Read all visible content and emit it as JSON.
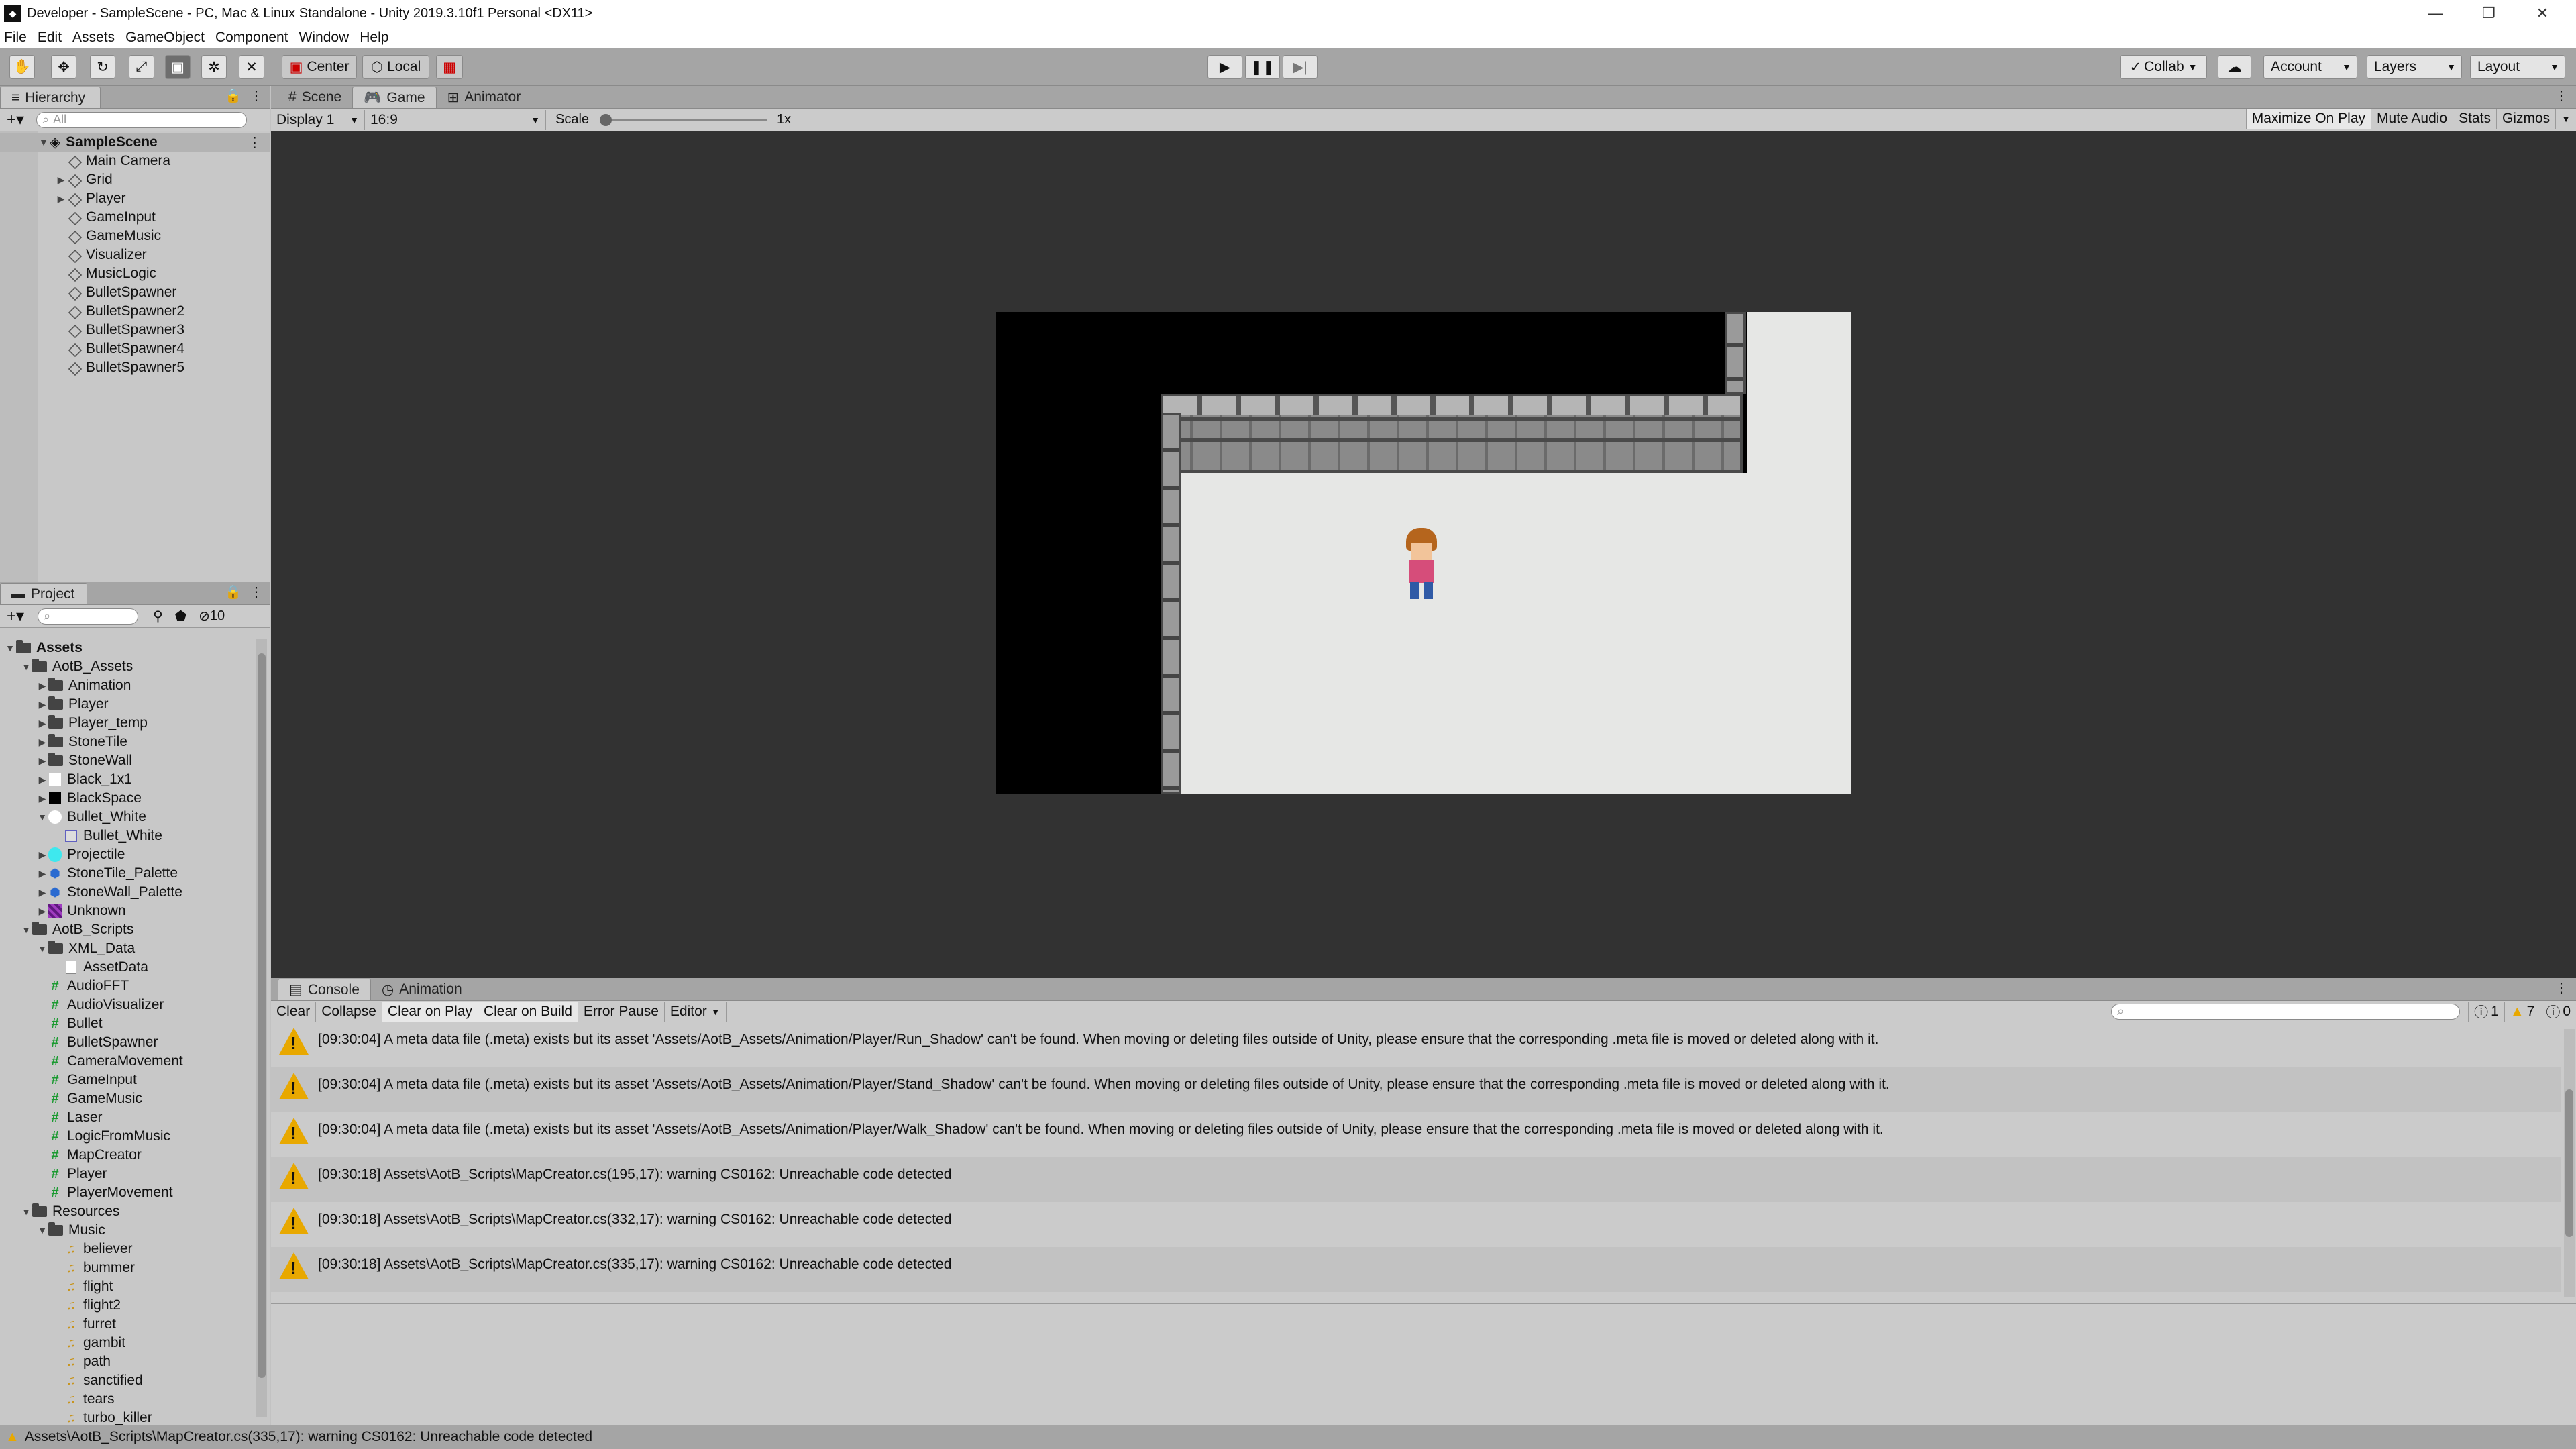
{
  "window": {
    "title": "Developer - SampleScene - PC, Mac & Linux Standalone - Unity 2019.3.10f1 Personal <DX11>"
  },
  "menu": [
    "File",
    "Edit",
    "Assets",
    "GameObject",
    "Component",
    "Window",
    "Help"
  ],
  "toolbar": {
    "center": "Center",
    "local": "Local",
    "collab": "Collab",
    "account": "Account",
    "layers": "Layers",
    "layout": "Layout"
  },
  "hierarchy": {
    "tab": "Hierarchy",
    "search_placeholder": "All",
    "scene": "SampleScene",
    "items": [
      "Main Camera",
      "Grid",
      "Player",
      "GameInput",
      "GameMusic",
      "Visualizer",
      "MusicLogic",
      "BulletSpawner",
      "BulletSpawner2",
      "BulletSpawner3",
      "BulletSpawner4",
      "BulletSpawner5"
    ]
  },
  "project": {
    "tab": "Project",
    "hidden_count": "10",
    "tree": [
      {
        "label": "Assets",
        "depth": 0,
        "type": "folder",
        "arrow": "down",
        "bold": true
      },
      {
        "label": "AotB_Assets",
        "depth": 1,
        "type": "folder",
        "arrow": "down"
      },
      {
        "label": "Animation",
        "depth": 2,
        "type": "folder",
        "arrow": "right"
      },
      {
        "label": "Player",
        "depth": 2,
        "type": "folder",
        "arrow": "right"
      },
      {
        "label": "Player_temp",
        "depth": 2,
        "type": "folder",
        "arrow": "right"
      },
      {
        "label": "StoneTile",
        "depth": 2,
        "type": "folder",
        "arrow": "right"
      },
      {
        "label": "StoneWall",
        "depth": 2,
        "type": "folder",
        "arrow": "right"
      },
      {
        "label": "Black_1x1",
        "depth": 2,
        "type": "white",
        "arrow": "right"
      },
      {
        "label": "BlackSpace",
        "depth": 2,
        "type": "black",
        "arrow": "right"
      },
      {
        "label": "Bullet_White",
        "depth": 2,
        "type": "circle",
        "arrow": "down"
      },
      {
        "label": "Bullet_White",
        "depth": 3,
        "type": "sprite",
        "arrow": ""
      },
      {
        "label": "Projectile",
        "depth": 2,
        "type": "cyan",
        "arrow": "right"
      },
      {
        "label": "StoneTile_Palette",
        "depth": 2,
        "type": "prefab",
        "arrow": "right"
      },
      {
        "label": "StoneWall_Palette",
        "depth": 2,
        "type": "prefab",
        "arrow": "right"
      },
      {
        "label": "Unknown",
        "depth": 2,
        "type": "purple",
        "arrow": "right"
      },
      {
        "label": "AotB_Scripts",
        "depth": 1,
        "type": "folder",
        "arrow": "down"
      },
      {
        "label": "XML_Data",
        "depth": 2,
        "type": "folder",
        "arrow": "down"
      },
      {
        "label": "AssetData",
        "depth": 3,
        "type": "doc",
        "arrow": ""
      },
      {
        "label": "AudioFFT",
        "depth": 2,
        "type": "script",
        "arrow": ""
      },
      {
        "label": "AudioVisualizer",
        "depth": 2,
        "type": "script",
        "arrow": ""
      },
      {
        "label": "Bullet",
        "depth": 2,
        "type": "script",
        "arrow": ""
      },
      {
        "label": "BulletSpawner",
        "depth": 2,
        "type": "script",
        "arrow": ""
      },
      {
        "label": "CameraMovement",
        "depth": 2,
        "type": "script",
        "arrow": ""
      },
      {
        "label": "GameInput",
        "depth": 2,
        "type": "script",
        "arrow": ""
      },
      {
        "label": "GameMusic",
        "depth": 2,
        "type": "script",
        "arrow": ""
      },
      {
        "label": "Laser",
        "depth": 2,
        "type": "script",
        "arrow": ""
      },
      {
        "label": "LogicFromMusic",
        "depth": 2,
        "type": "script",
        "arrow": ""
      },
      {
        "label": "MapCreator",
        "depth": 2,
        "type": "script",
        "arrow": ""
      },
      {
        "label": "Player",
        "depth": 2,
        "type": "script",
        "arrow": ""
      },
      {
        "label": "PlayerMovement",
        "depth": 2,
        "type": "script",
        "arrow": ""
      },
      {
        "label": "Resources",
        "depth": 1,
        "type": "folder",
        "arrow": "down"
      },
      {
        "label": "Music",
        "depth": 2,
        "type": "folder",
        "arrow": "down"
      },
      {
        "label": "believer",
        "depth": 3,
        "type": "audio",
        "arrow": ""
      },
      {
        "label": "bummer",
        "depth": 3,
        "type": "audio",
        "arrow": ""
      },
      {
        "label": "flight",
        "depth": 3,
        "type": "audio",
        "arrow": ""
      },
      {
        "label": "flight2",
        "depth": 3,
        "type": "audio",
        "arrow": ""
      },
      {
        "label": "furret",
        "depth": 3,
        "type": "audio",
        "arrow": ""
      },
      {
        "label": "gambit",
        "depth": 3,
        "type": "audio",
        "arrow": ""
      },
      {
        "label": "path",
        "depth": 3,
        "type": "audio",
        "arrow": ""
      },
      {
        "label": "sanctified",
        "depth": 3,
        "type": "audio",
        "arrow": ""
      },
      {
        "label": "tears",
        "depth": 3,
        "type": "audio",
        "arrow": ""
      },
      {
        "label": "turbo_killer",
        "depth": 3,
        "type": "audio",
        "arrow": ""
      }
    ]
  },
  "center_tabs": {
    "scene": "Scene",
    "game": "Game",
    "animator": "Animator"
  },
  "game": {
    "display": "Display 1",
    "aspect": "16:9",
    "scale_label": "Scale",
    "scale_value": "1x",
    "maximize": "Maximize On Play",
    "mute": "Mute Audio",
    "stats": "Stats",
    "gizmos": "Gizmos"
  },
  "console": {
    "tab": "Console",
    "animation_tab": "Animation",
    "clear": "Clear",
    "collapse": "Collapse",
    "clear_on_play": "Clear on Play",
    "clear_on_build": "Clear on Build",
    "error_pause": "Error Pause",
    "editor": "Editor",
    "count_info": "1",
    "count_warn": "7",
    "count_error": "0",
    "logs": [
      "[09:30:04] A meta data file (.meta) exists but its asset 'Assets/AotB_Assets/Animation/Player/Run_Shadow' can't be found. When moving or deleting files outside of Unity, please ensure that the corresponding .meta file is moved or deleted along with it.",
      "[09:30:04] A meta data file (.meta) exists but its asset 'Assets/AotB_Assets/Animation/Player/Stand_Shadow' can't be found. When moving or deleting files outside of Unity, please ensure that the corresponding .meta file is moved or deleted along with it.",
      "[09:30:04] A meta data file (.meta) exists but its asset 'Assets/AotB_Assets/Animation/Player/Walk_Shadow' can't be found. When moving or deleting files outside of Unity, please ensure that the corresponding .meta file is moved or deleted along with it.",
      "[09:30:18] Assets\\AotB_Scripts\\MapCreator.cs(195,17): warning CS0162: Unreachable code detected",
      "[09:30:18] Assets\\AotB_Scripts\\MapCreator.cs(332,17): warning CS0162: Unreachable code detected",
      "[09:30:18] Assets\\AotB_Scripts\\MapCreator.cs(335,17): warning CS0162: Unreachable code detected"
    ]
  },
  "statusbar": {
    "text": "Assets\\AotB_Scripts\\MapCreator.cs(335,17): warning CS0162: Unreachable code detected"
  },
  "colors": {
    "editor_bg": "#c2c2c2",
    "game_bg": "#323232",
    "floor": "#e6e7e5",
    "warning": "#e8a800"
  }
}
